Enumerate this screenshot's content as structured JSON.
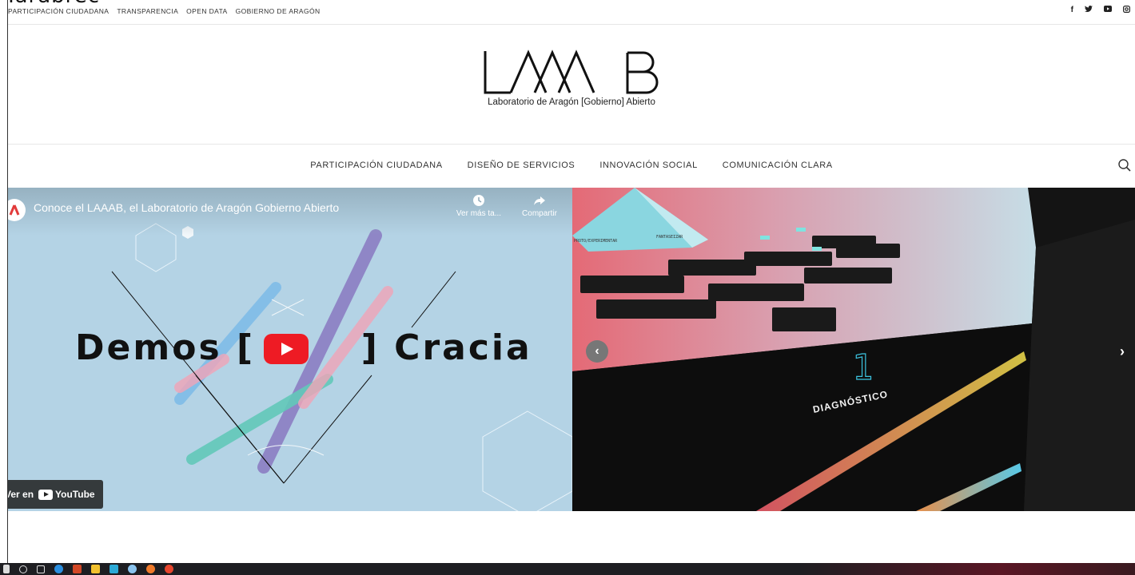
{
  "cut_text": "Tarabrec",
  "topbar": {
    "links": [
      "PARTICIPACIÓN CIUDADANA",
      "TRANSPARENCIA",
      "OPEN DATA",
      "GOBIERNO DE ARAGÓN"
    ],
    "social_icons": [
      "facebook-icon",
      "twitter-icon",
      "youtube-icon",
      "instagram-icon"
    ]
  },
  "logo": {
    "tagline": "Laboratorio de Aragón [Gobierno] Abierto"
  },
  "nav": {
    "items": [
      "PARTICIPACIÓN CIUDADANA",
      "DISEÑO DE SERVICIOS",
      "INNOVACIÓN SOCIAL",
      "COMUNICACIÓN CLARA"
    ]
  },
  "video": {
    "title": "Conoce el LAAAB, el Laboratorio de Aragón Gobierno Abierto",
    "watch_later": "Ver más ta...",
    "share": "Compartir",
    "headline_left": "Demos [",
    "headline_right": "] Cracia",
    "watch_on": "Ver en",
    "youtube": "YouTube"
  },
  "slider": {
    "pyramid_label_1": "PROTO/EXPERIMENTAR",
    "pyramid_label_2": "FANTASEIZAR",
    "box_label": "DIAGNÓSTICO",
    "box_number": "1"
  },
  "colors": {
    "video_bg": "#b4d3e5",
    "youtube_red": "#ee1b24",
    "slider_bg": "#141414"
  }
}
